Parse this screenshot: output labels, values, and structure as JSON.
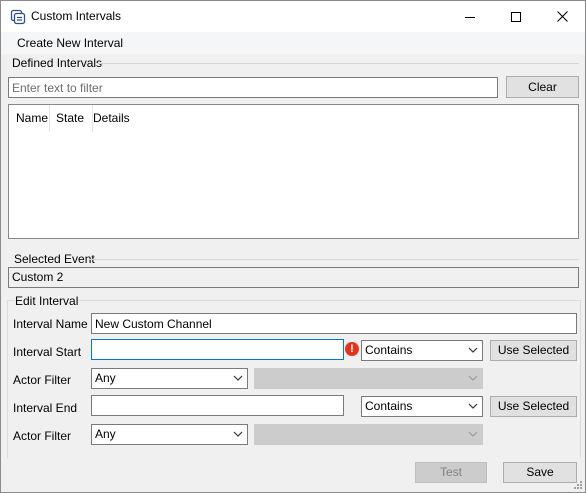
{
  "window": {
    "title": "Custom Intervals",
    "icon": "app-window-icon",
    "controls": [
      "minimize-icon",
      "maximize-icon",
      "close-icon"
    ]
  },
  "menu": {
    "create_new_interval": "Create New Interval"
  },
  "defined_intervals": {
    "label": "Defined Intervals",
    "filter_placeholder": "Enter text to filter",
    "filter_value": "",
    "clear_label": "Clear",
    "columns": [
      "Name",
      "State",
      "Details"
    ],
    "rows": []
  },
  "selected_event": {
    "label": "Selected Event",
    "value": "Custom 2"
  },
  "edit_interval": {
    "label": "Edit Interval",
    "interval_name_label": "Interval Name",
    "interval_name_value": "New Custom Channel",
    "interval_start_label": "Interval Start",
    "interval_start_value": "",
    "start_match_value": "Contains",
    "use_selected_label": "Use Selected",
    "actor_filter_label": "Actor Filter",
    "actor_filter_value": "Any",
    "actor_filter_secondary_value": "",
    "interval_end_label": "Interval End",
    "interval_end_value": "",
    "end_match_value": "Contains",
    "end_use_selected_label": "Use Selected",
    "end_actor_filter_label": "Actor Filter",
    "end_actor_filter_value": "Any",
    "end_actor_filter_secondary_value": ""
  },
  "footer": {
    "test_label": "Test",
    "save_label": "Save"
  },
  "colors": {
    "focus_border": "#0078d7",
    "error": "#e0361f",
    "window_bg": "#f0f0f0"
  }
}
